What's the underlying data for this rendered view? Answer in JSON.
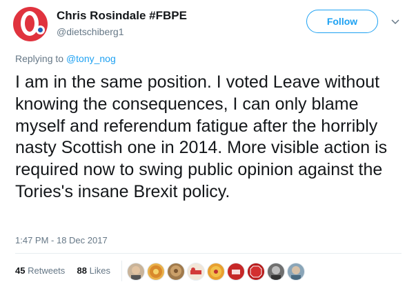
{
  "author": {
    "name": "Chris Rosindale #FBPE",
    "handle": "@dietschiberg1"
  },
  "follow_label": "Follow",
  "reply": {
    "prefix": "Replying to ",
    "to": "@tony_nog"
  },
  "tweet_text": "I am in the same position. I voted Leave without knowing the consequences, I can only blame myself and referendum fatigue after the horribly nasty Scottish one in 2014. More visible action is required now to swing public opinion against the Tories's insane Brexit policy.",
  "timestamp": "1:47 PM - 18 Dec 2017",
  "stats": {
    "retweets_count": "45",
    "retweets_label": "Retweets",
    "likes_count": "88",
    "likes_label": "Likes"
  },
  "likers": [
    {
      "id": "liker-1"
    },
    {
      "id": "liker-2"
    },
    {
      "id": "liker-3"
    },
    {
      "id": "liker-4"
    },
    {
      "id": "liker-5"
    },
    {
      "id": "liker-6"
    },
    {
      "id": "liker-7"
    },
    {
      "id": "liker-8"
    },
    {
      "id": "liker-9"
    }
  ],
  "colors": {
    "accent": "#1da1f2",
    "text": "#14171a",
    "muted": "#657786",
    "avatar_bg": "#e0333e"
  }
}
